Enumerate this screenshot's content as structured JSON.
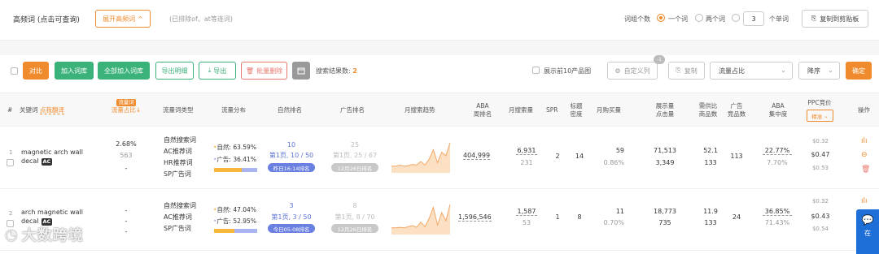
{
  "header": {
    "title": "高频词 (点击可查询)",
    "expand_label": "展开高频词",
    "note": "(已排除of、at等连词)",
    "word_count_label": "词组个数",
    "opt_one": "一个词",
    "opt_two": "两个词",
    "opt_n_value": "3",
    "opt_n_suffix": "个单词",
    "copy_clipboard": "复制到剪贴板"
  },
  "toolbar": {
    "compare": "对比",
    "add_lib": "加入词库",
    "add_all_lib": "全部加入词库",
    "export_detail": "导出明细",
    "export": "导出",
    "batch_delete": "批量删除",
    "result_label": "搜索结果数:",
    "result_count": "2",
    "show_top10": "展示前10产品图",
    "custom_cols": "自定义列",
    "custom_badge": "-1",
    "copy": "复制",
    "sort_field": "流量占比",
    "sort_order": "降序",
    "confirm": "确定"
  },
  "table": {
    "headers": {
      "idx": "#",
      "keyword": "关键词",
      "translate": "点我翻译",
      "tag": "流量词",
      "traffic_share": "流量占比",
      "word_type": "流量词类型",
      "traffic_dist": "流量分布",
      "natural_rank": "自然排名",
      "ad_rank": "广告排名",
      "trend": "月搜索趋势",
      "aba_1": "ABA",
      "aba_2": "周排名",
      "monthly_search": "月搜索量",
      "spr": "SPR",
      "title_density_1": "标题",
      "title_density_2": "密度",
      "monthly_buy": "月购买量",
      "impressions_1": "展示量",
      "impressions_2": "点击量",
      "supply_1": "需供比",
      "supply_2": "商品数",
      "ad_products_1": "广告",
      "ad_products_2": "竞品数",
      "aba_conc_1": "ABA",
      "aba_conc_2": "集中度",
      "ppc": "PPC竞价",
      "ppc_dropdown": "精准",
      "ops": "操作"
    },
    "rows": [
      {
        "idx": "1",
        "keyword_l1": "magnetic arch wall",
        "keyword_l2": "decal",
        "ac": "AC",
        "share": "2.68%",
        "share_sub": "563",
        "share_dash": "-",
        "types": [
          "自然搜索词",
          "AC推荐词",
          "HR推荐词",
          "SP广告词"
        ],
        "nat_label": "自然:",
        "nat_pct": "63.59%",
        "ad_label": "广告:",
        "ad_pct": "36.41%",
        "nat_share": 0.6359,
        "nr_value": "10",
        "nr_page": "第1页, 10 / 50",
        "nr_pill": "昨日16:14排名",
        "ar_value": "25",
        "ar_page": "第1页, 25 / 67",
        "ar_pill": "12月26日排名",
        "trend": [
          1,
          1,
          1.2,
          1,
          1.1,
          1.3,
          1.2,
          1.8,
          1.2,
          2.2,
          3.8,
          1.6,
          3.4,
          2.8,
          5.0
        ],
        "aba": "404,999",
        "search": "6,931",
        "search_sub": "231",
        "spr": "2",
        "density": "14",
        "buy": "59",
        "buy_sub": "0.86%",
        "imp": "71,513",
        "click": "3,349",
        "supply": "52.1",
        "products": "133",
        "ad_products": "113",
        "conc": "22.77%",
        "conc_sub": "7.70%",
        "ppc_low": "$0.32",
        "ppc_mid": "$0.47",
        "ppc_high": "$0.53"
      },
      {
        "idx": "2",
        "keyword_l1": "arch magnetic wall",
        "keyword_l2": "decal",
        "ac": "AC",
        "share": "-",
        "share_sub": "-",
        "share_dash": "-",
        "types": [
          "自然搜索词",
          "AC推荐词",
          "SP广告词"
        ],
        "nat_label": "自然:",
        "nat_pct": "47.04%",
        "ad_label": "广告:",
        "ad_pct": "52.95%",
        "nat_share": 0.4704,
        "nr_value": "3",
        "nr_page": "第1页, 3 / 50",
        "nr_pill": "今日05:08排名",
        "ar_value": "8",
        "ar_page": "第1页, 8 / 70",
        "ar_pill": "12月26日排名",
        "trend": [
          1,
          1,
          1.1,
          1,
          1.2,
          1.4,
          1.1,
          2.0,
          1.2,
          2.6,
          4.5,
          1.5,
          3.6,
          2.2,
          5.0
        ],
        "aba": "1,596,546",
        "search": "1,587",
        "search_sub": "53",
        "spr": "1",
        "density": "8",
        "buy": "11",
        "buy_sub": "0.70%",
        "imp": "18,773",
        "click": "735",
        "supply": "11.9",
        "products": "133",
        "ad_products": "24",
        "conc": "36.85%",
        "conc_sub": "71.43%",
        "ppc_low": "$0.32",
        "ppc_mid": "$0.43",
        "ppc_high": "$0.54"
      }
    ]
  },
  "watermark": "大数跨境",
  "side_chat_label": "在",
  "colors": {
    "accent": "#f08b2d",
    "green": "#3bb27a",
    "red": "#e8776f",
    "blue": "#6a80e0"
  }
}
